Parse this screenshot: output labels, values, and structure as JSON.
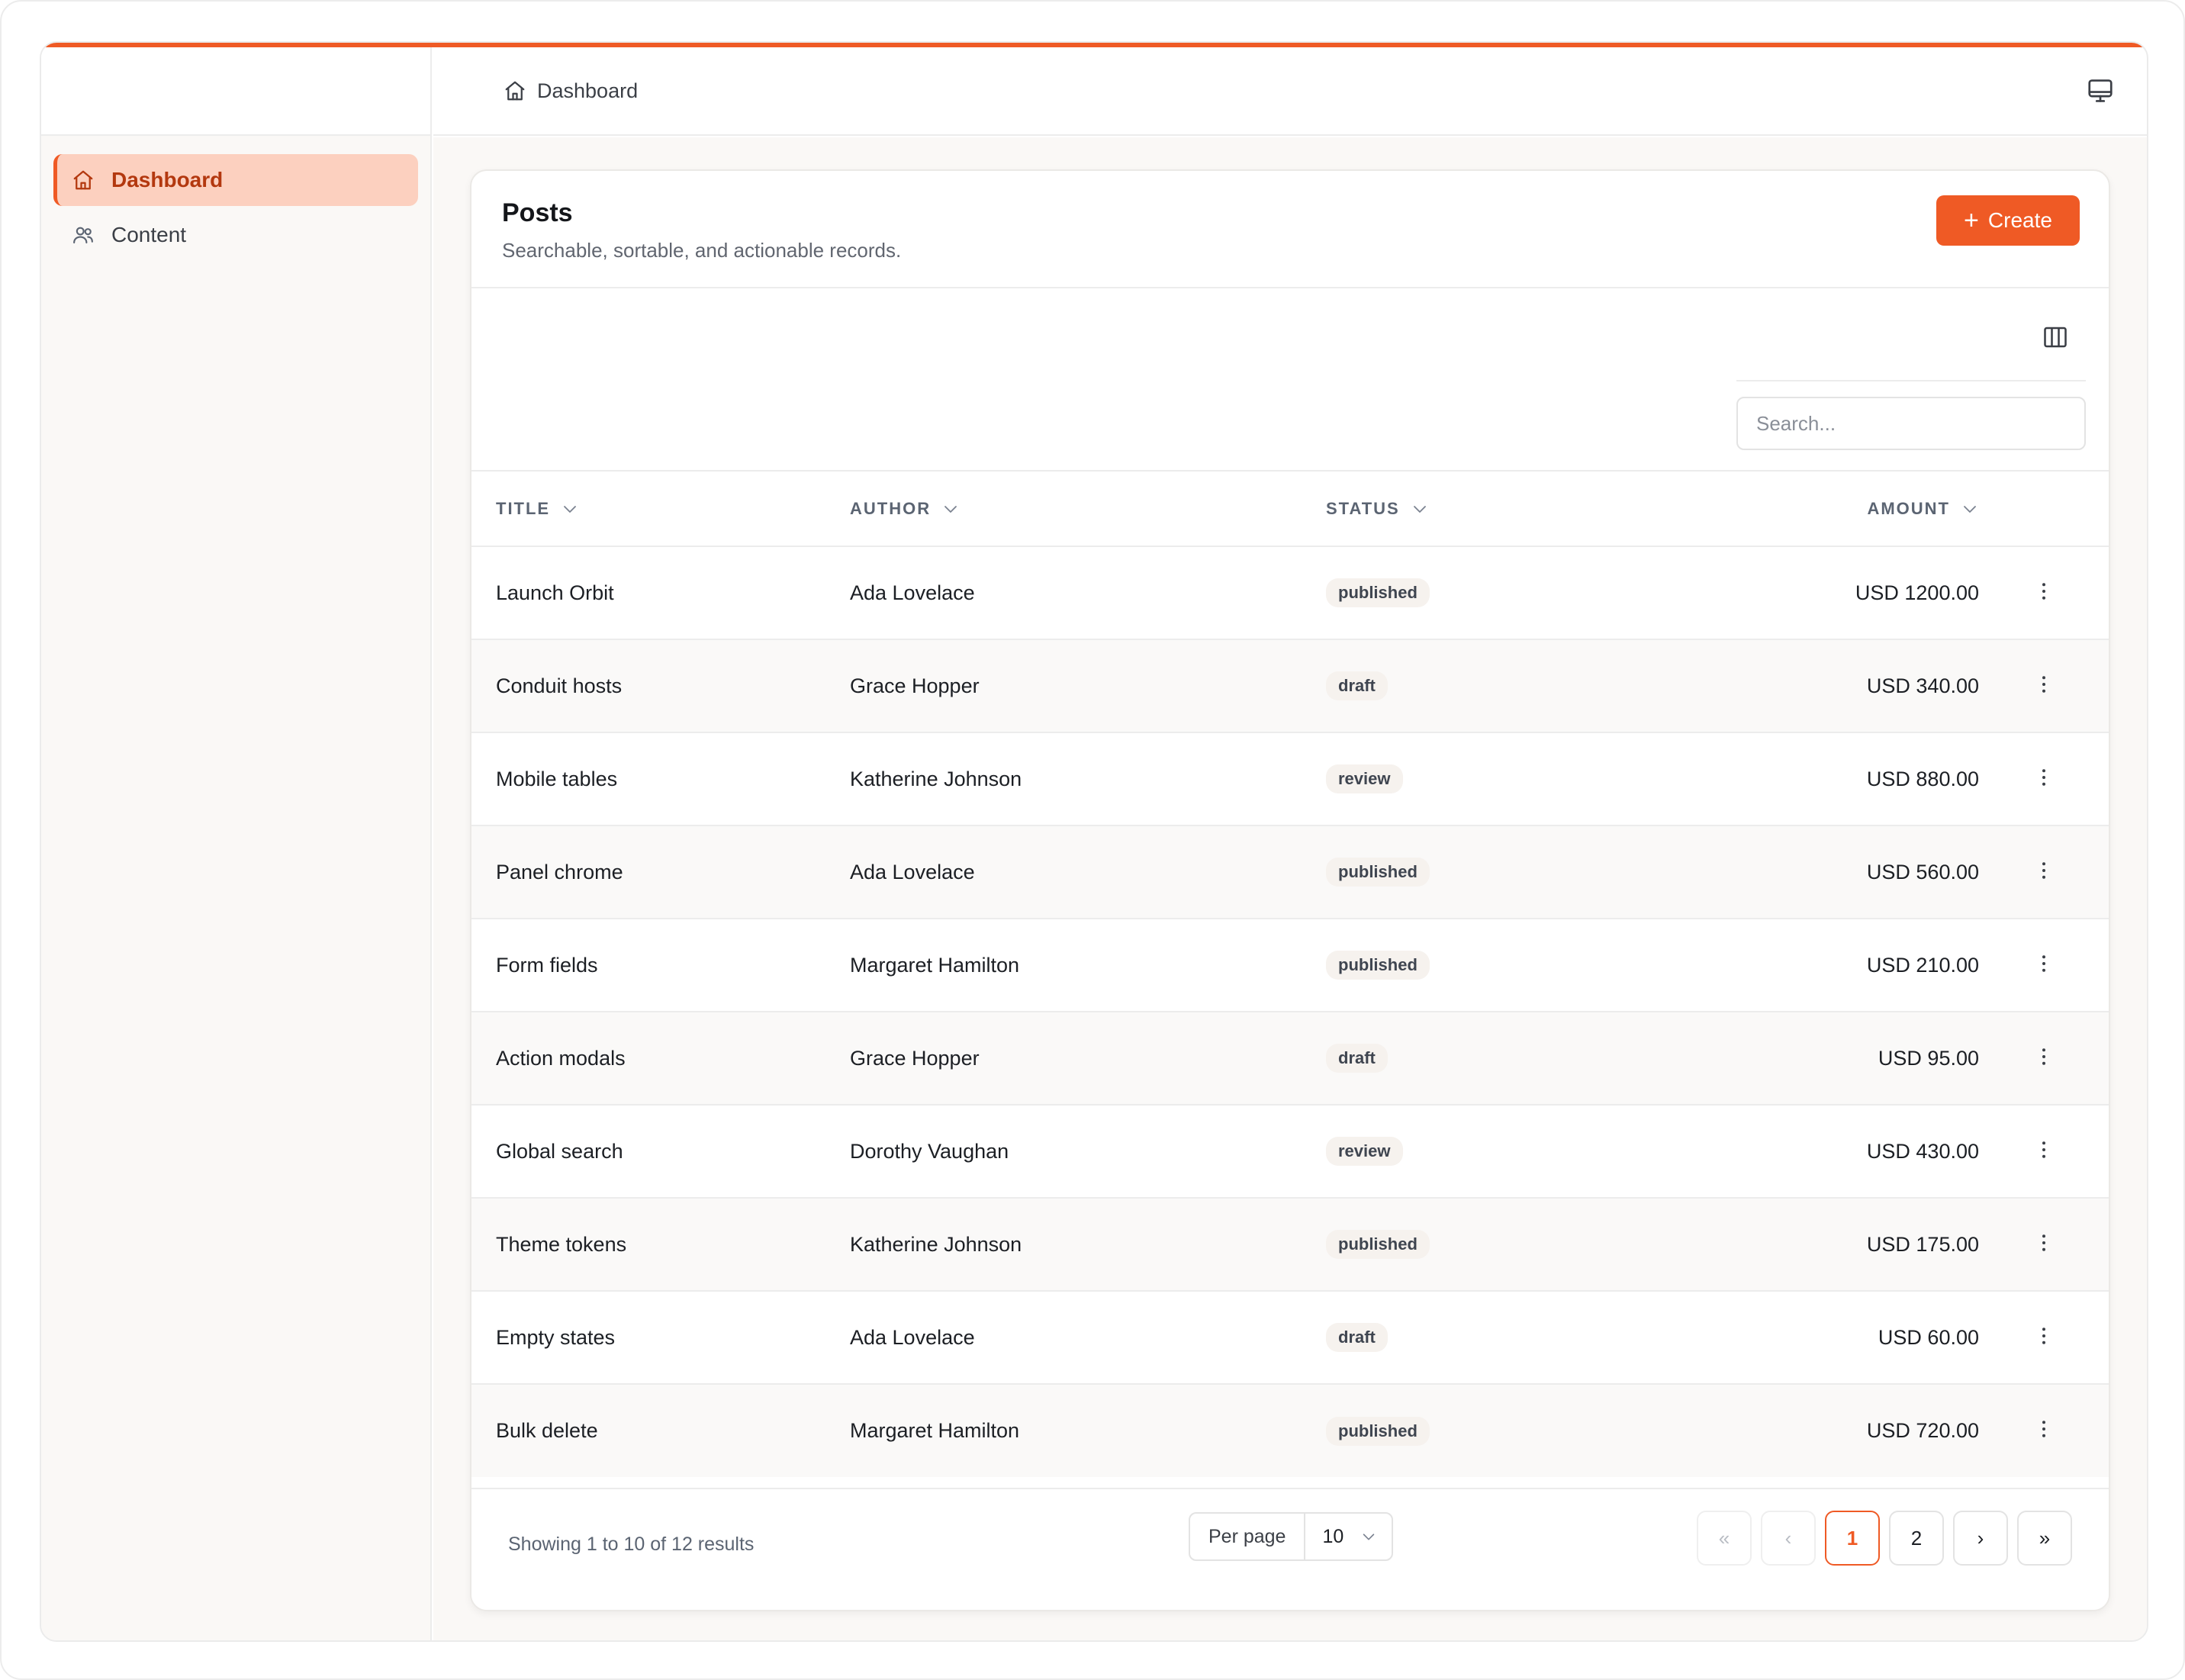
{
  "breadcrumb": {
    "label": "Dashboard"
  },
  "sidebar": {
    "items": [
      {
        "label": "Dashboard",
        "icon": "home-icon",
        "active": true
      },
      {
        "label": "Content",
        "icon": "users-icon",
        "active": false
      }
    ]
  },
  "page": {
    "title": "Posts",
    "subtitle": "Searchable, sortable, and actionable records.",
    "create_label": "Create"
  },
  "search": {
    "placeholder": "Search..."
  },
  "table": {
    "headers": {
      "title": "TITLE",
      "author": "AUTHOR",
      "status": "STATUS",
      "amount": "AMOUNT"
    },
    "rows": [
      {
        "title": "Launch Orbit",
        "author": "Ada Lovelace",
        "status": "published",
        "amount": "USD 1200.00"
      },
      {
        "title": "Conduit hosts",
        "author": "Grace Hopper",
        "status": "draft",
        "amount": "USD 340.00"
      },
      {
        "title": "Mobile tables",
        "author": "Katherine Johnson",
        "status": "review",
        "amount": "USD 880.00"
      },
      {
        "title": "Panel chrome",
        "author": "Ada Lovelace",
        "status": "published",
        "amount": "USD 560.00"
      },
      {
        "title": "Form fields",
        "author": "Margaret Hamilton",
        "status": "published",
        "amount": "USD 210.00"
      },
      {
        "title": "Action modals",
        "author": "Grace Hopper",
        "status": "draft",
        "amount": "USD 95.00"
      },
      {
        "title": "Global search",
        "author": "Dorothy Vaughan",
        "status": "review",
        "amount": "USD 430.00"
      },
      {
        "title": "Theme tokens",
        "author": "Katherine Johnson",
        "status": "published",
        "amount": "USD 175.00"
      },
      {
        "title": "Empty states",
        "author": "Ada Lovelace",
        "status": "draft",
        "amount": "USD 60.00"
      },
      {
        "title": "Bulk delete",
        "author": "Margaret Hamilton",
        "status": "published",
        "amount": "USD 720.00"
      }
    ]
  },
  "footer": {
    "showing": "Showing 1 to 10 of 12 results",
    "per_page_label": "Per page",
    "per_page_value": "10",
    "pager": {
      "first": "«",
      "prev": "‹",
      "pages": [
        "1",
        "2"
      ],
      "current": "1",
      "next": "›",
      "last": "»"
    }
  },
  "colors": {
    "accent": "#ef5a25",
    "active_nav_bg": "#fcd0bf",
    "active_nav_text": "#b3380f"
  }
}
